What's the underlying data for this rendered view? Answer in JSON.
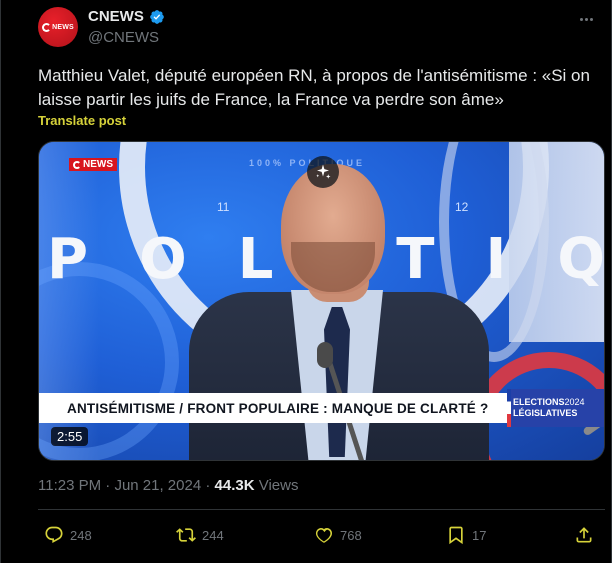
{
  "colors": {
    "accent": "#d6d23a",
    "verified": "#1d9bf0",
    "brand_red": "#d8151e",
    "muted": "#71767b"
  },
  "author": {
    "display_name": "CNEWS",
    "handle": "@CNEWS",
    "avatar_text": "NEWS",
    "verified_icon": "verified-badge-icon"
  },
  "post": {
    "text": "Matthieu Valet, député européen RN, à propos de l'antisémitisme : «Si on laisse partir les juifs de France, la France va perdre son âme»",
    "translate_label": "Translate post"
  },
  "video": {
    "channel_bug": "NEWS",
    "studio_text": "POLITIQ",
    "studio_letters": [
      "P",
      "O",
      "L",
      "I",
      "T",
      "I",
      "Q"
    ],
    "tick_left": "11",
    "tick_right": "12",
    "top_strip": "100% POLITIQUE",
    "lower_third": "ANTISÉMITISME / FRONT POPULAIRE : MANQUE DE CLARTÉ ?",
    "elections_top": "ELECTIONS",
    "elections_year": "2024",
    "elections_bottom": "LÉGISLATIVES",
    "duration": "2:55"
  },
  "meta": {
    "time": "11:23 PM",
    "separator": "·",
    "date": "Jun 21, 2024",
    "views_count": "44.3K",
    "views_label": "Views"
  },
  "actions": {
    "replies": "248",
    "reposts": "244",
    "likes": "768",
    "bookmarks": "17"
  }
}
